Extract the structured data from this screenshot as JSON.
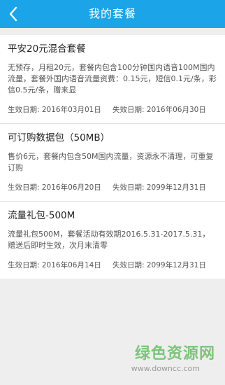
{
  "header": {
    "title": "我的套餐",
    "back_icon": "chevron-left-icon"
  },
  "packages": [
    {
      "name": "平安20元混合套餐",
      "description": "无预存，月租20元，套餐内包含100分钟国内语音100M国内流量，套餐外国内语音流量资费：0.15元，短信0.1元/条，彩信0.5元/条，赠来显",
      "effective_date": "生效日期: 2016年03月01日",
      "expiry_date": "失效日期: 2016年06月30日"
    },
    {
      "name": "可订购数据包（50MB）",
      "description": "售价6元，套餐内包含50M国内流量，资源永不清理，可重复订购",
      "effective_date": "生效日期: 2016年06月20日",
      "expiry_date": "失效日期: 2099年12月31日"
    },
    {
      "name": "流量礼包-500M",
      "description": "流量礼包500M，套餐活动有效期2016.5.31-2017.5.31，赠送后即时生效，次月末清零",
      "effective_date": "生效日期: 2016年06月14日",
      "expiry_date": "失效日期: 2099年12月31日"
    }
  ],
  "watermark": {
    "text": "绿色资源网",
    "url": "www.downcc.com"
  },
  "colors": {
    "header_bg": "#1ba4e8",
    "page_bg": "#eeeeee",
    "watermark_green": "#7cc47a"
  }
}
